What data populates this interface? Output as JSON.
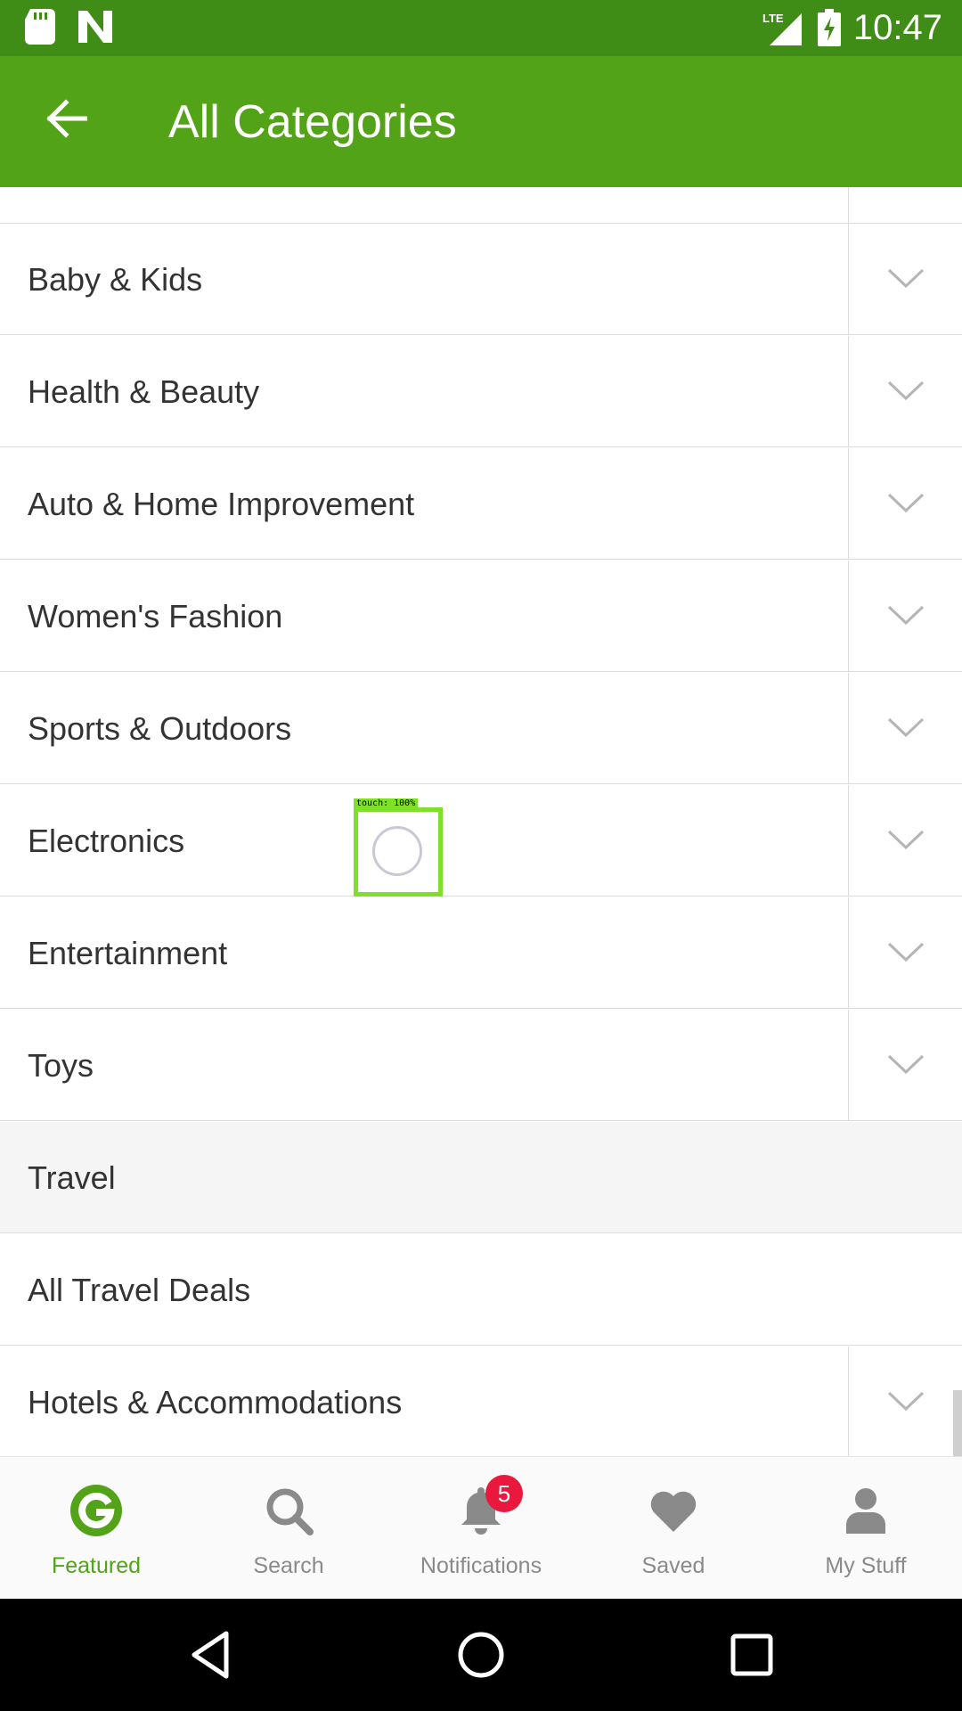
{
  "status_bar": {
    "time": "10:47",
    "network": "LTE",
    "icons": [
      "sd-card-icon",
      "n-notification-icon",
      "lte-signal-icon",
      "battery-charging-icon"
    ]
  },
  "app_bar": {
    "title": "All Categories",
    "back_icon": "arrow-left-icon"
  },
  "categories": [
    {
      "label": "Baby & Kids",
      "expandable": true,
      "header": false
    },
    {
      "label": "Health & Beauty",
      "expandable": true,
      "header": false
    },
    {
      "label": "Auto & Home Improvement",
      "expandable": true,
      "header": false
    },
    {
      "label": "Women's Fashion",
      "expandable": true,
      "header": false
    },
    {
      "label": "Sports & Outdoors",
      "expandable": true,
      "header": false
    },
    {
      "label": "Electronics",
      "expandable": true,
      "header": false
    },
    {
      "label": "Entertainment",
      "expandable": true,
      "header": false
    },
    {
      "label": "Toys",
      "expandable": true,
      "header": false
    },
    {
      "label": "Travel",
      "expandable": false,
      "header": true
    },
    {
      "label": "All Travel Deals",
      "expandable": false,
      "header": false
    },
    {
      "label": "Hotels & Accommodations",
      "expandable": true,
      "header": false
    }
  ],
  "touch_overlay": {
    "label": "touch: 100%"
  },
  "bottom_nav": {
    "items": [
      {
        "label": "Featured",
        "icon": "groupon-g-icon",
        "active": true
      },
      {
        "label": "Search",
        "icon": "search-icon",
        "active": false
      },
      {
        "label": "Notifications",
        "icon": "bell-icon",
        "active": false
      },
      {
        "label": "Saved",
        "icon": "heart-icon",
        "active": false
      },
      {
        "label": "My Stuff",
        "icon": "person-icon",
        "active": false
      }
    ],
    "notification_badge": "5"
  },
  "colors": {
    "status_bar": "#3f8d17",
    "app_bar": "#53a318",
    "active": "#53a318",
    "inactive": "#8a8a8a",
    "badge": "#e8193c"
  }
}
